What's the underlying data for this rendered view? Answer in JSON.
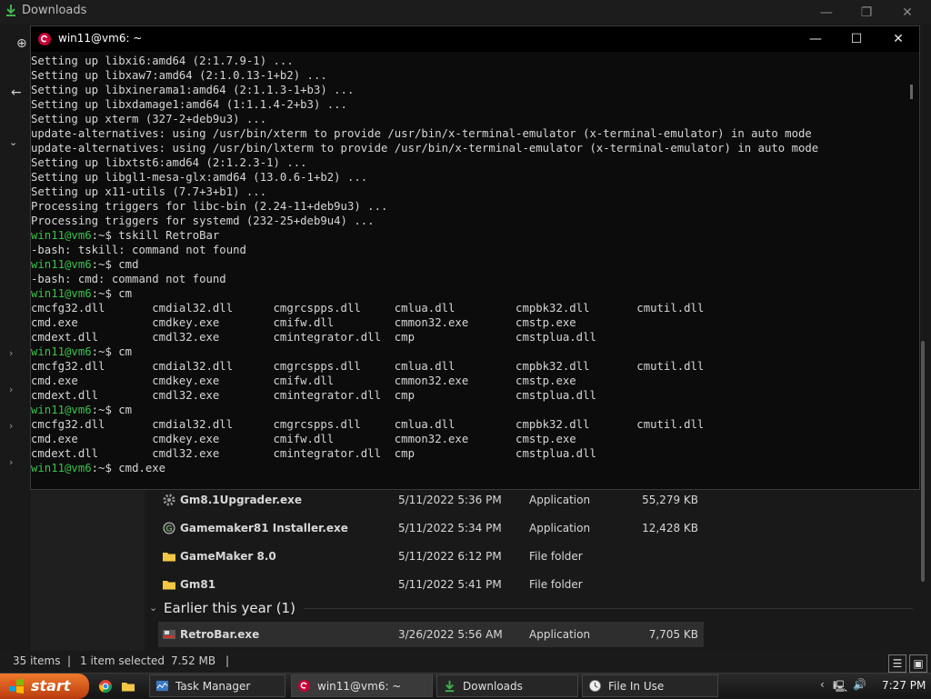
{
  "explorer": {
    "title": "Downloads",
    "files": [
      {
        "name": "Gm8.1Upgrader.exe",
        "date": "5/11/2022 5:36 PM",
        "type": "Application",
        "size": "55,279 KB",
        "icon": "gear-app-icon"
      },
      {
        "name": "Gamemaker81 Installer.exe",
        "date": "5/11/2022 5:34 PM",
        "type": "Application",
        "size": "12,428 KB",
        "icon": "gamemaker-icon"
      },
      {
        "name": "GameMaker 8.0",
        "date": "5/11/2022 6:12 PM",
        "type": "File folder",
        "size": "",
        "icon": "folder-icon"
      },
      {
        "name": "Gm81",
        "date": "5/11/2022 5:41 PM",
        "type": "File folder",
        "size": "",
        "icon": "folder-icon"
      }
    ],
    "group_header": "Earlier this year (1)",
    "selected_file": {
      "name": "RetroBar.exe",
      "date": "3/26/2022 5:56 AM",
      "type": "Application",
      "size": "7,705 KB",
      "icon": "retrobar-icon"
    },
    "status": {
      "items": "35 items",
      "selected": "1 item selected",
      "size": "7.52 MB",
      "sep": "|"
    }
  },
  "terminal": {
    "title": "win11@vm6: ~",
    "prompt": "win11@vm6",
    "prompt_path": ":~$ ",
    "lines": [
      {
        "t": "out",
        "text": "Setting up libxi6:amd64 (2:1.7.9-1) ..."
      },
      {
        "t": "out",
        "text": "Setting up libxaw7:amd64 (2:1.0.13-1+b2) ..."
      },
      {
        "t": "out",
        "text": "Setting up libxinerama1:amd64 (2:1.1.3-1+b3) ..."
      },
      {
        "t": "out",
        "text": "Setting up libxdamage1:amd64 (1:1.1.4-2+b3) ..."
      },
      {
        "t": "out",
        "text": "Setting up xterm (327-2+deb9u3) ..."
      },
      {
        "t": "out",
        "text": "update-alternatives: using /usr/bin/xterm to provide /usr/bin/x-terminal-emulator (x-terminal-emulator) in auto mode"
      },
      {
        "t": "out",
        "text": "update-alternatives: using /usr/bin/lxterm to provide /usr/bin/x-terminal-emulator (x-terminal-emulator) in auto mode"
      },
      {
        "t": "out",
        "text": "Setting up libxtst6:amd64 (2:1.2.3-1) ..."
      },
      {
        "t": "out",
        "text": "Setting up libgl1-mesa-glx:amd64 (13.0.6-1+b2) ..."
      },
      {
        "t": "out",
        "text": "Setting up x11-utils (7.7+3+b1) ..."
      },
      {
        "t": "out",
        "text": "Processing triggers for libc-bin (2.24-11+deb9u3) ..."
      },
      {
        "t": "out",
        "text": "Processing triggers for systemd (232-25+deb9u4) ..."
      },
      {
        "t": "cmd",
        "text": "tskill RetroBar"
      },
      {
        "t": "out",
        "text": "-bash: tskill: command not found"
      },
      {
        "t": "cmd",
        "text": "cmd"
      },
      {
        "t": "out",
        "text": "-bash: cmd: command not found"
      },
      {
        "t": "cmd",
        "text": "cm"
      },
      {
        "t": "out",
        "text": "cmcfg32.dll       cmdial32.dll      cmgrcspps.dll     cmlua.dll         cmpbk32.dll       cmutil.dll"
      },
      {
        "t": "out",
        "text": "cmd.exe           cmdkey.exe        cmifw.dll         cmmon32.exe       cmstp.exe"
      },
      {
        "t": "out",
        "text": "cmdext.dll        cmdl32.exe        cmintegrator.dll  cmp               cmstplua.dll"
      },
      {
        "t": "cmd",
        "text": "cm"
      },
      {
        "t": "out",
        "text": "cmcfg32.dll       cmdial32.dll      cmgrcspps.dll     cmlua.dll         cmpbk32.dll       cmutil.dll"
      },
      {
        "t": "out",
        "text": "cmd.exe           cmdkey.exe        cmifw.dll         cmmon32.exe       cmstp.exe"
      },
      {
        "t": "out",
        "text": "cmdext.dll        cmdl32.exe        cmintegrator.dll  cmp               cmstplua.dll"
      },
      {
        "t": "cmd",
        "text": "cm"
      },
      {
        "t": "out",
        "text": "cmcfg32.dll       cmdial32.dll      cmgrcspps.dll     cmlua.dll         cmpbk32.dll       cmutil.dll"
      },
      {
        "t": "out",
        "text": "cmd.exe           cmdkey.exe        cmifw.dll         cmmon32.exe       cmstp.exe"
      },
      {
        "t": "out",
        "text": "cmdext.dll        cmdl32.exe        cmintegrator.dll  cmp               cmstplua.dll"
      },
      {
        "t": "cmd",
        "text": "cmd.exe"
      }
    ]
  },
  "taskbar": {
    "start_label": "start",
    "tasks": [
      {
        "label": "Task Manager",
        "icon": "task-manager-icon"
      },
      {
        "label": "win11@vm6: ~",
        "icon": "debian-icon"
      },
      {
        "label": "Downloads",
        "icon": "download-icon"
      },
      {
        "label": "File In Use",
        "icon": "clock-icon"
      }
    ],
    "clock": "7:27 PM"
  },
  "colors": {
    "prompt_green": "#38c24a",
    "start_orange": "#e0622a"
  }
}
